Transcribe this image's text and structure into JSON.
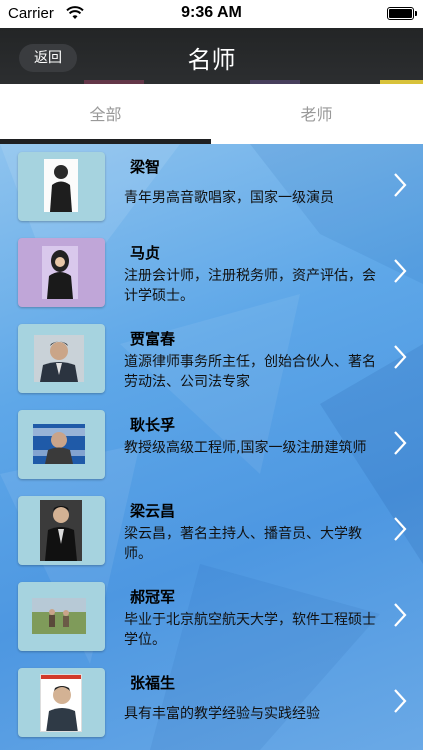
{
  "status": {
    "carrier": "Carrier",
    "time": "9:36 AM"
  },
  "nav": {
    "back_label": "返回",
    "title": "名师"
  },
  "tabs": [
    {
      "label": "全部"
    },
    {
      "label": "老师"
    }
  ],
  "teachers": [
    {
      "name": "梁智",
      "desc": "青年男高音歌唱家，国家一级演员",
      "thumb_bg": "#a6d3df"
    },
    {
      "name": "马贞",
      "desc": "注册会计师，注册税务师，资产评估，会计学硕士。",
      "thumb_bg": "#c0a6d8"
    },
    {
      "name": "贾富春",
      "desc": "道源律师事务所主任，创始合伙人、著名劳动法、公司法专家",
      "thumb_bg": "#a6d3df"
    },
    {
      "name": "耿长孚",
      "desc": "教授级高级工程师,国家一级注册建筑师",
      "thumb_bg": "#a6d3df"
    },
    {
      "name": "梁云昌",
      "desc": "梁云昌，著名主持人、播音员、大学教师。",
      "thumb_bg": "#a6d3df"
    },
    {
      "name": "郝冠军",
      "desc": "毕业于北京航空航天大学，软件工程硕士学位。",
      "thumb_bg": "#a6d3df"
    },
    {
      "name": "张福生",
      "desc": "具有丰富的教学经验与实践经验",
      "thumb_bg": "#a6d3df"
    }
  ]
}
